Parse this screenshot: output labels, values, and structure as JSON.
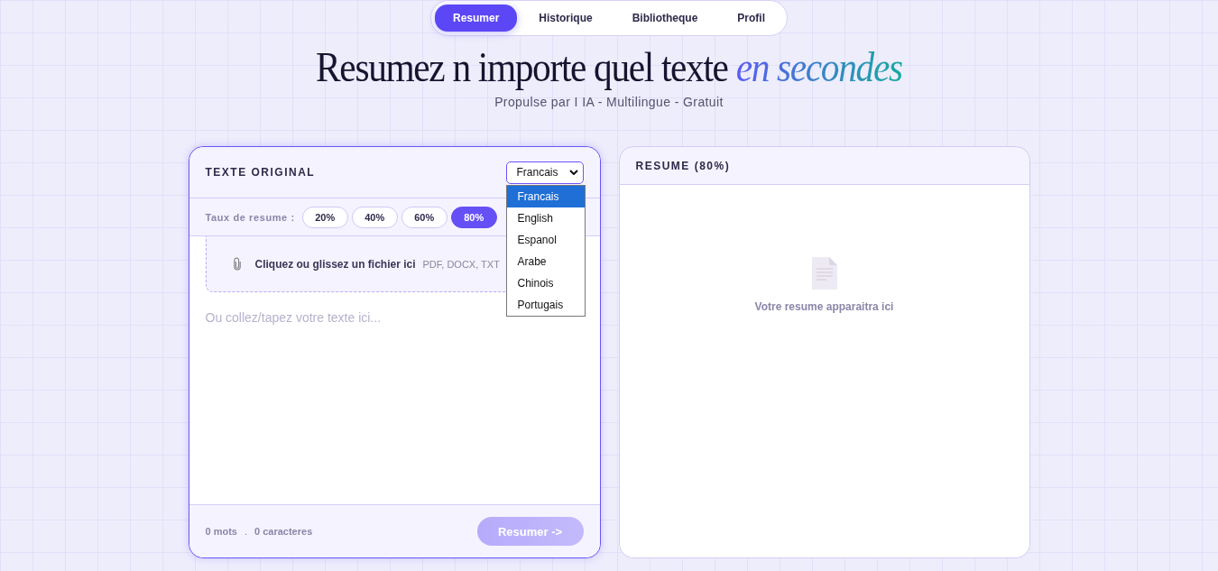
{
  "nav": [
    {
      "label": "Resumer",
      "selected": true
    },
    {
      "label": "Historique",
      "selected": false
    },
    {
      "label": "Bibliotheque",
      "selected": false
    },
    {
      "label": "Profil",
      "selected": false
    }
  ],
  "hero": {
    "title": "Resumez n importe quel texte",
    "title_accent": "en secondes",
    "subtitle": "Propulse par I IA - Multilingue - Gratuit"
  },
  "source_panel": {
    "title": "TEXTE ORIGINAL",
    "language_value": "Francais",
    "language_menu": {
      "expanded": true,
      "options": [
        {
          "label": "Francais",
          "selected": true
        },
        {
          "label": "English",
          "selected": false
        },
        {
          "label": "Espanol",
          "selected": false
        },
        {
          "label": "Arabe",
          "selected": false
        },
        {
          "label": "Chinois",
          "selected": false
        },
        {
          "label": "Portugais",
          "selected": false
        }
      ]
    },
    "rate_label": "Taux de resume :",
    "rates": [
      {
        "label": "20%",
        "selected": false
      },
      {
        "label": "40%",
        "selected": false
      },
      {
        "label": "60%",
        "selected": false
      },
      {
        "label": "80%",
        "selected": true
      }
    ],
    "dropzone": {
      "label": "Cliquez ou glissez un fichier ici",
      "formats": "PDF, DOCX, TXT"
    },
    "text_placeholder": "Ou collez/tapez votre texte ici...",
    "word_count": "0 mots",
    "separator": ".",
    "char_count": "0 caracteres",
    "submit": {
      "label": "Resumer ->",
      "disabled": true
    }
  },
  "result_panel": {
    "title": "RESUME (80%)",
    "empty_message": "Votre resume apparaitra ici"
  }
}
